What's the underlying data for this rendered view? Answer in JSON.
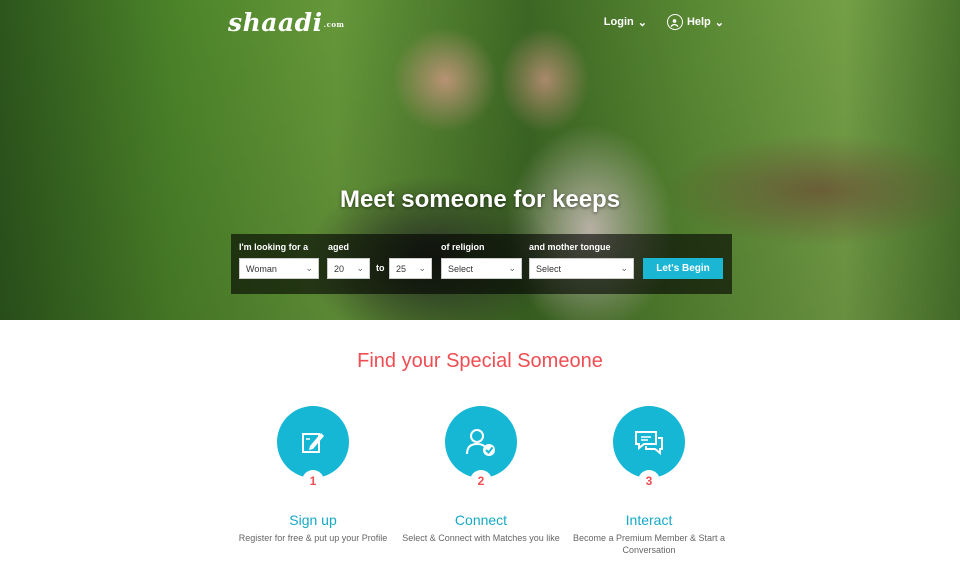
{
  "brand": {
    "logo": "shaadi",
    "logo_suffix": ".com"
  },
  "nav": {
    "login": "Login",
    "help": "Help"
  },
  "hero": {
    "headline": "Meet someone for keeps"
  },
  "search": {
    "looking_label": "I'm looking for a",
    "looking_value": "Woman",
    "aged_label": "aged",
    "age_from": "20",
    "to_label": "to",
    "age_to": "25",
    "religion_label": "of religion",
    "religion_value": "Select",
    "tongue_label": "and mother tongue",
    "tongue_value": "Select",
    "button": "Let's Begin"
  },
  "section": {
    "title": "Find your Special Someone"
  },
  "steps": [
    {
      "num": "1",
      "title": "Sign up",
      "desc": "Register for free & put up your Profile",
      "icon": "edit-icon"
    },
    {
      "num": "2",
      "title": "Connect",
      "desc": "Select & Connect with Matches you like",
      "icon": "user-check-icon"
    },
    {
      "num": "3",
      "title": "Interact",
      "desc": "Become a Premium Member & Start a Conversation",
      "icon": "chat-icon"
    }
  ],
  "colors": {
    "accent": "#15b7d5",
    "heading": "#f04d52",
    "button": "#1ab6d4"
  }
}
